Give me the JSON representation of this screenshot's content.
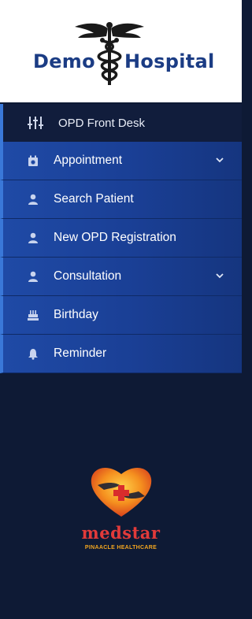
{
  "header": {
    "brand_left": "Demo",
    "brand_right": "Hospital",
    "logo_icon": "caduceus-icon"
  },
  "menu": {
    "header": {
      "label": "OPD Front Desk",
      "icon": "sliders-icon"
    },
    "items": [
      {
        "label": "Appointment",
        "icon": "calendar-icon",
        "has_submenu": true
      },
      {
        "label": "Search Patient",
        "icon": "user-icon",
        "has_submenu": false
      },
      {
        "label": "New OPD Registration",
        "icon": "user-icon",
        "has_submenu": false
      },
      {
        "label": "Consultation",
        "icon": "user-icon",
        "has_submenu": true
      },
      {
        "label": "Birthday",
        "icon": "cake-icon",
        "has_submenu": false
      },
      {
        "label": "Reminder",
        "icon": "bell-icon",
        "has_submenu": false
      }
    ]
  },
  "footer": {
    "brand": "medstar",
    "tagline": "PINAACLE HEALTHCARE",
    "logo_icon": "heart-hands-icon"
  },
  "colors": {
    "sidebar_bg": "#0e1a35",
    "menu_item_bg": "#1f4aa6",
    "brand_blue": "#1b3c84",
    "medstar_red": "#e23a3a",
    "medstar_orange": "#f2a51f"
  }
}
